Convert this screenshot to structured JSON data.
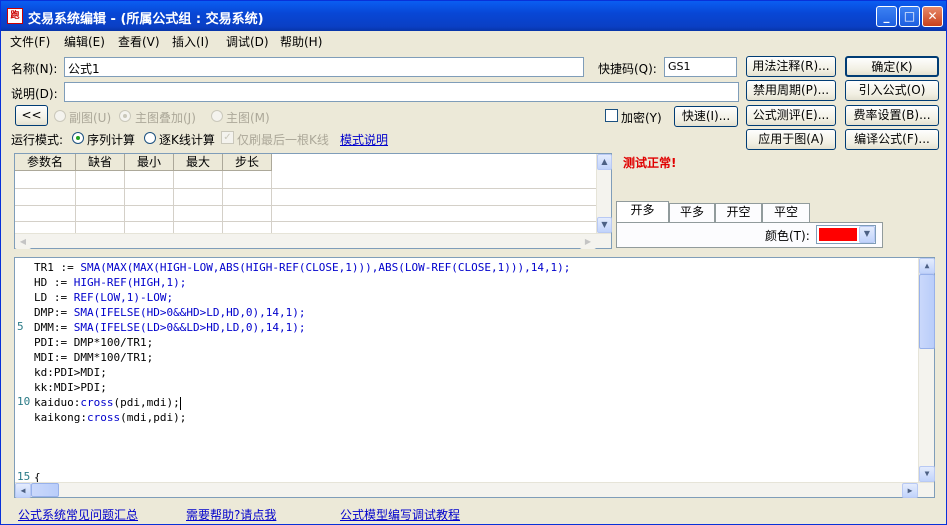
{
  "window": {
    "app_icon": "跑",
    "title": "交易系统编辑 - (所属公式组 : 交易系统)",
    "controls": {
      "minimize": "_",
      "maximize": "□",
      "close": "✕"
    }
  },
  "menu": [
    "文件(F)",
    "编辑(E)",
    "查看(V)",
    "插入(I)",
    "调试(D)",
    "帮助(H)"
  ],
  "form": {
    "name_label": "名称(N):",
    "name_value": "公式1",
    "shortcut_label": "快捷码(Q):",
    "shortcut_value": "GS1",
    "desc_label": "说明(D):",
    "desc_value": "",
    "collapse_label": "<<",
    "sub_chart": "副图(U)",
    "main_overlay": "主图叠加(J)",
    "main_chart": "主图(M)",
    "encrypt": "加密(Y)",
    "quick_label": "快速(I)...",
    "mode_label": "运行模式:",
    "mode_seq": "序列计算",
    "mode_kline": "逐K线计算",
    "refresh_last": "仅刷最后一根K线",
    "mode_help": "模式说明"
  },
  "right_buttons": {
    "usage_note": "用法注释(R)...",
    "ok": "确定(K)",
    "disable_period": "禁用周期(P)...",
    "import_formula": "引入公式(O)",
    "formula_eval": "公式测评(E)...",
    "fee_setting": "费率设置(B)...",
    "apply_chart": "应用于图(A)",
    "translate": "编译公式(F)..."
  },
  "params_table": {
    "headers": [
      "参数名",
      "缺省",
      "最小",
      "最大",
      "步长"
    ]
  },
  "status": {
    "message": "测试正常!",
    "color": "#e00000"
  },
  "signal_tabs": [
    "开多",
    "平多",
    "开空",
    "平空"
  ],
  "color_label": "颜色(T):",
  "signal_color": "#ff0000",
  "code_lines": [
    {
      "ln": "",
      "parts": [
        [
          "TR1 := ",
          "n"
        ],
        [
          "SMA(MAX(MAX(HIGH-LOW,ABS(HIGH-REF(CLOSE,1))),ABS(LOW-REF(CLOSE,1))),14,1);",
          "k"
        ]
      ]
    },
    {
      "ln": "",
      "parts": [
        [
          "HD := ",
          "n"
        ],
        [
          "HIGH-REF(HIGH,1);",
          "k"
        ]
      ]
    },
    {
      "ln": "",
      "parts": [
        [
          "LD := ",
          "n"
        ],
        [
          "REF(LOW,1)-LOW;",
          "k"
        ]
      ]
    },
    {
      "ln": "",
      "parts": [
        [
          "DMP:= ",
          "n"
        ],
        [
          "SMA(IFELSE(HD>0&&HD>LD,HD,0),14,1);",
          "k"
        ]
      ]
    },
    {
      "ln": "5",
      "parts": [
        [
          "DMM:= ",
          "n"
        ],
        [
          "SMA(IFELSE(LD>0&&LD>HD,LD,0),14,1);",
          "k"
        ]
      ]
    },
    {
      "ln": "",
      "parts": [
        [
          "PDI:= DMP*100/TR1;",
          "n"
        ]
      ]
    },
    {
      "ln": "",
      "parts": [
        [
          "MDI:= DMM*100/TR1;",
          "n"
        ]
      ]
    },
    {
      "ln": "",
      "parts": [
        [
          "kd:PDI>MDI;",
          "n"
        ]
      ]
    },
    {
      "ln": "",
      "parts": [
        [
          "kk:MDI>PDI;",
          "n"
        ]
      ]
    },
    {
      "ln": "10",
      "parts": [
        [
          "kaiduo:",
          "n"
        ],
        [
          "cross",
          "k"
        ],
        [
          "(pdi,mdi);",
          "n"
        ]
      ]
    },
    {
      "ln": "",
      "parts": [
        [
          "kaikong:",
          "n"
        ],
        [
          "cross",
          "k"
        ],
        [
          "(mdi,pdi);",
          "n"
        ]
      ]
    },
    {
      "ln": "",
      "parts": [
        [
          "",
          "n"
        ]
      ]
    },
    {
      "ln": "",
      "parts": [
        [
          "",
          "n"
        ]
      ]
    },
    {
      "ln": "",
      "parts": [
        [
          "",
          "n"
        ]
      ]
    },
    {
      "ln": "15",
      "parts": [
        [
          "{",
          "n"
        ]
      ]
    }
  ],
  "footer_links": [
    "公式系统常见问题汇总",
    "需要帮助?请点我",
    "公式模型编写调试教程"
  ]
}
